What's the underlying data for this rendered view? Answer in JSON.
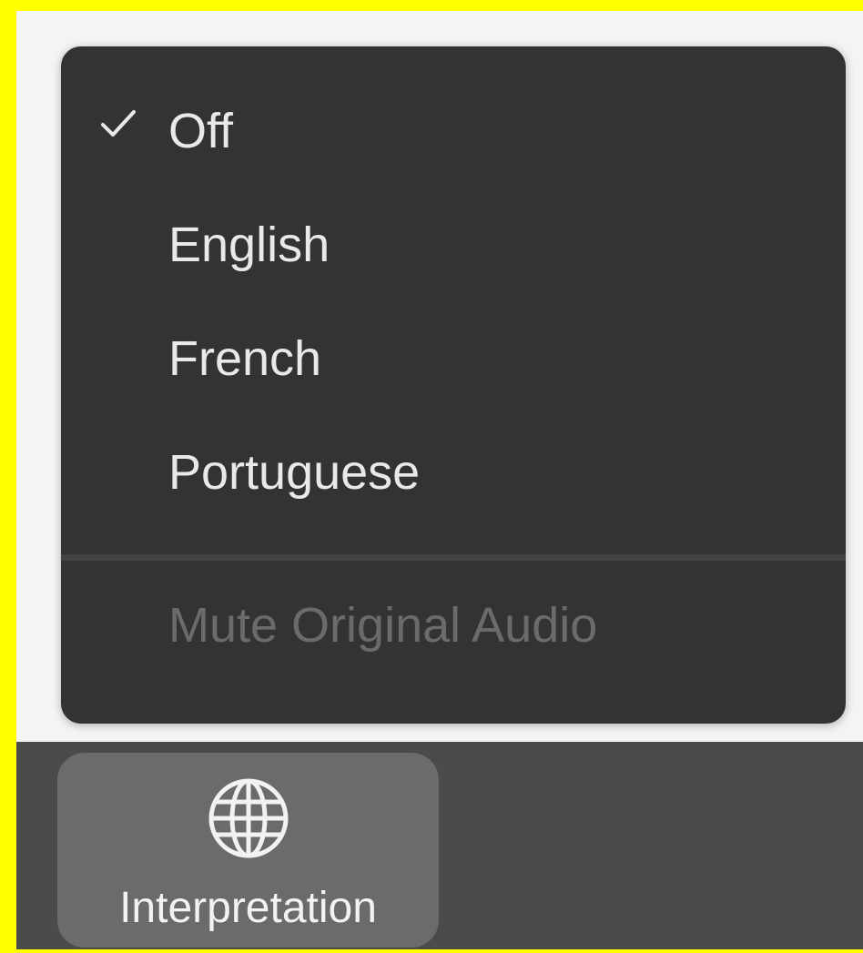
{
  "menu": {
    "items": [
      {
        "label": "Off",
        "checked": true,
        "enabled": true
      },
      {
        "label": "English",
        "checked": false,
        "enabled": true
      },
      {
        "label": "French",
        "checked": false,
        "enabled": true
      },
      {
        "label": "Portuguese",
        "checked": false,
        "enabled": true
      }
    ],
    "mute_label": "Mute Original Audio",
    "mute_enabled": false,
    "check_icon": "checkmark-icon"
  },
  "toolbar": {
    "interpretation_label": "Interpretation",
    "interpretation_icon": "globe-icon"
  },
  "colors": {
    "highlight_border": "#ffff00",
    "menu_background": "#333333",
    "menu_text": "#e9e9e9",
    "disabled_text": "#6b6b6b",
    "toolbar_background": "#4b4b4b",
    "button_background": "#6b6b6b"
  }
}
